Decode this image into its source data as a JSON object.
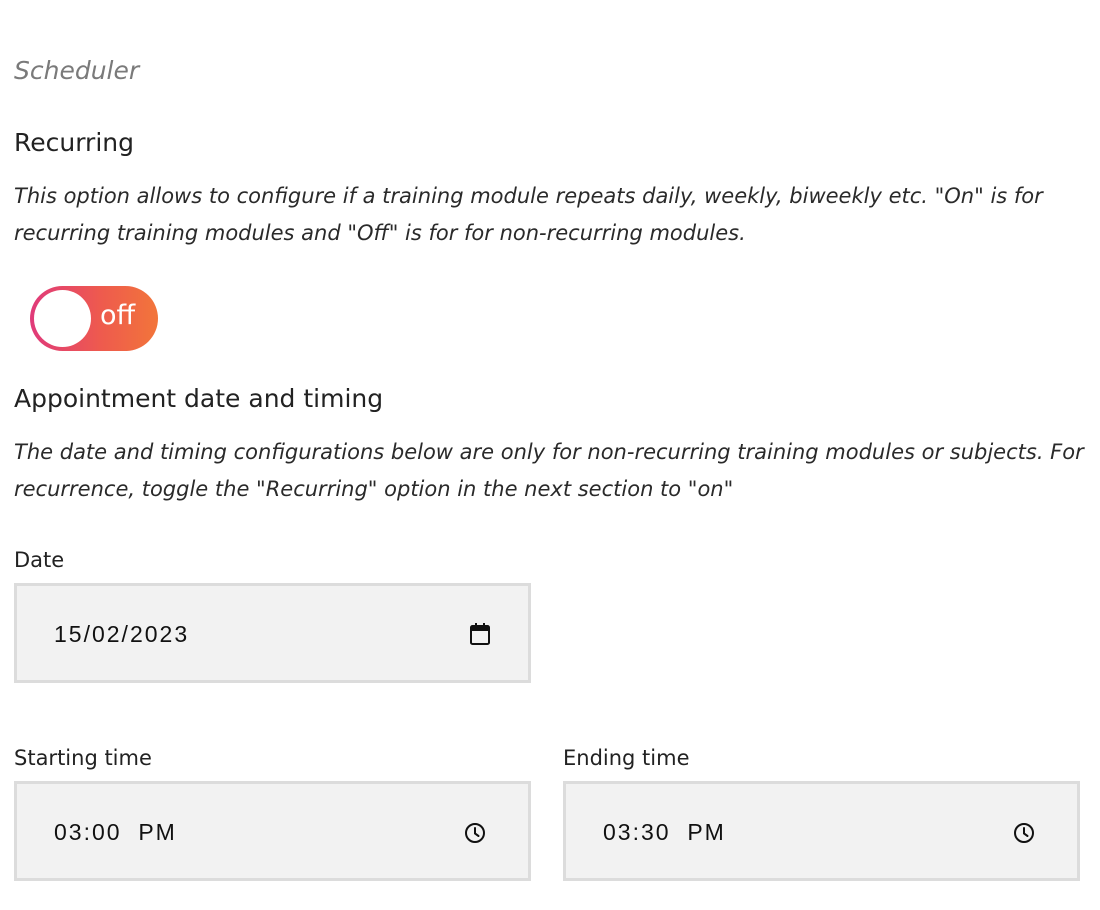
{
  "scheduler": {
    "section_label": "Scheduler"
  },
  "recurring": {
    "heading": "Recurring",
    "description": "This option allows to configure if a training module repeats daily, weekly, biweekly etc. \"On\" is for recurring training modules and \"Off\" is for for non-recurring modules.",
    "toggle_text": "off",
    "toggle_state": "off"
  },
  "appointment": {
    "heading": "Appointment date and timing",
    "description": "The date and timing configurations below are only for non-recurring training modules or subjects. For recurrence, toggle the \"Recurring\" option in the next section to \"on\"",
    "date": {
      "label": "Date",
      "value": "15/02/2023",
      "icon": "calendar-icon"
    },
    "start_time": {
      "label": "Starting time",
      "value": "03:00  PM",
      "icon": "clock-icon"
    },
    "end_time": {
      "label": "Ending time",
      "value": "03:30  PM",
      "icon": "clock-icon"
    }
  },
  "colors": {
    "toggle_gradient_start": "#e03a7a",
    "toggle_gradient_end": "#f2753a",
    "field_background": "#f2f2f2",
    "field_border": "#dcdcdc"
  }
}
